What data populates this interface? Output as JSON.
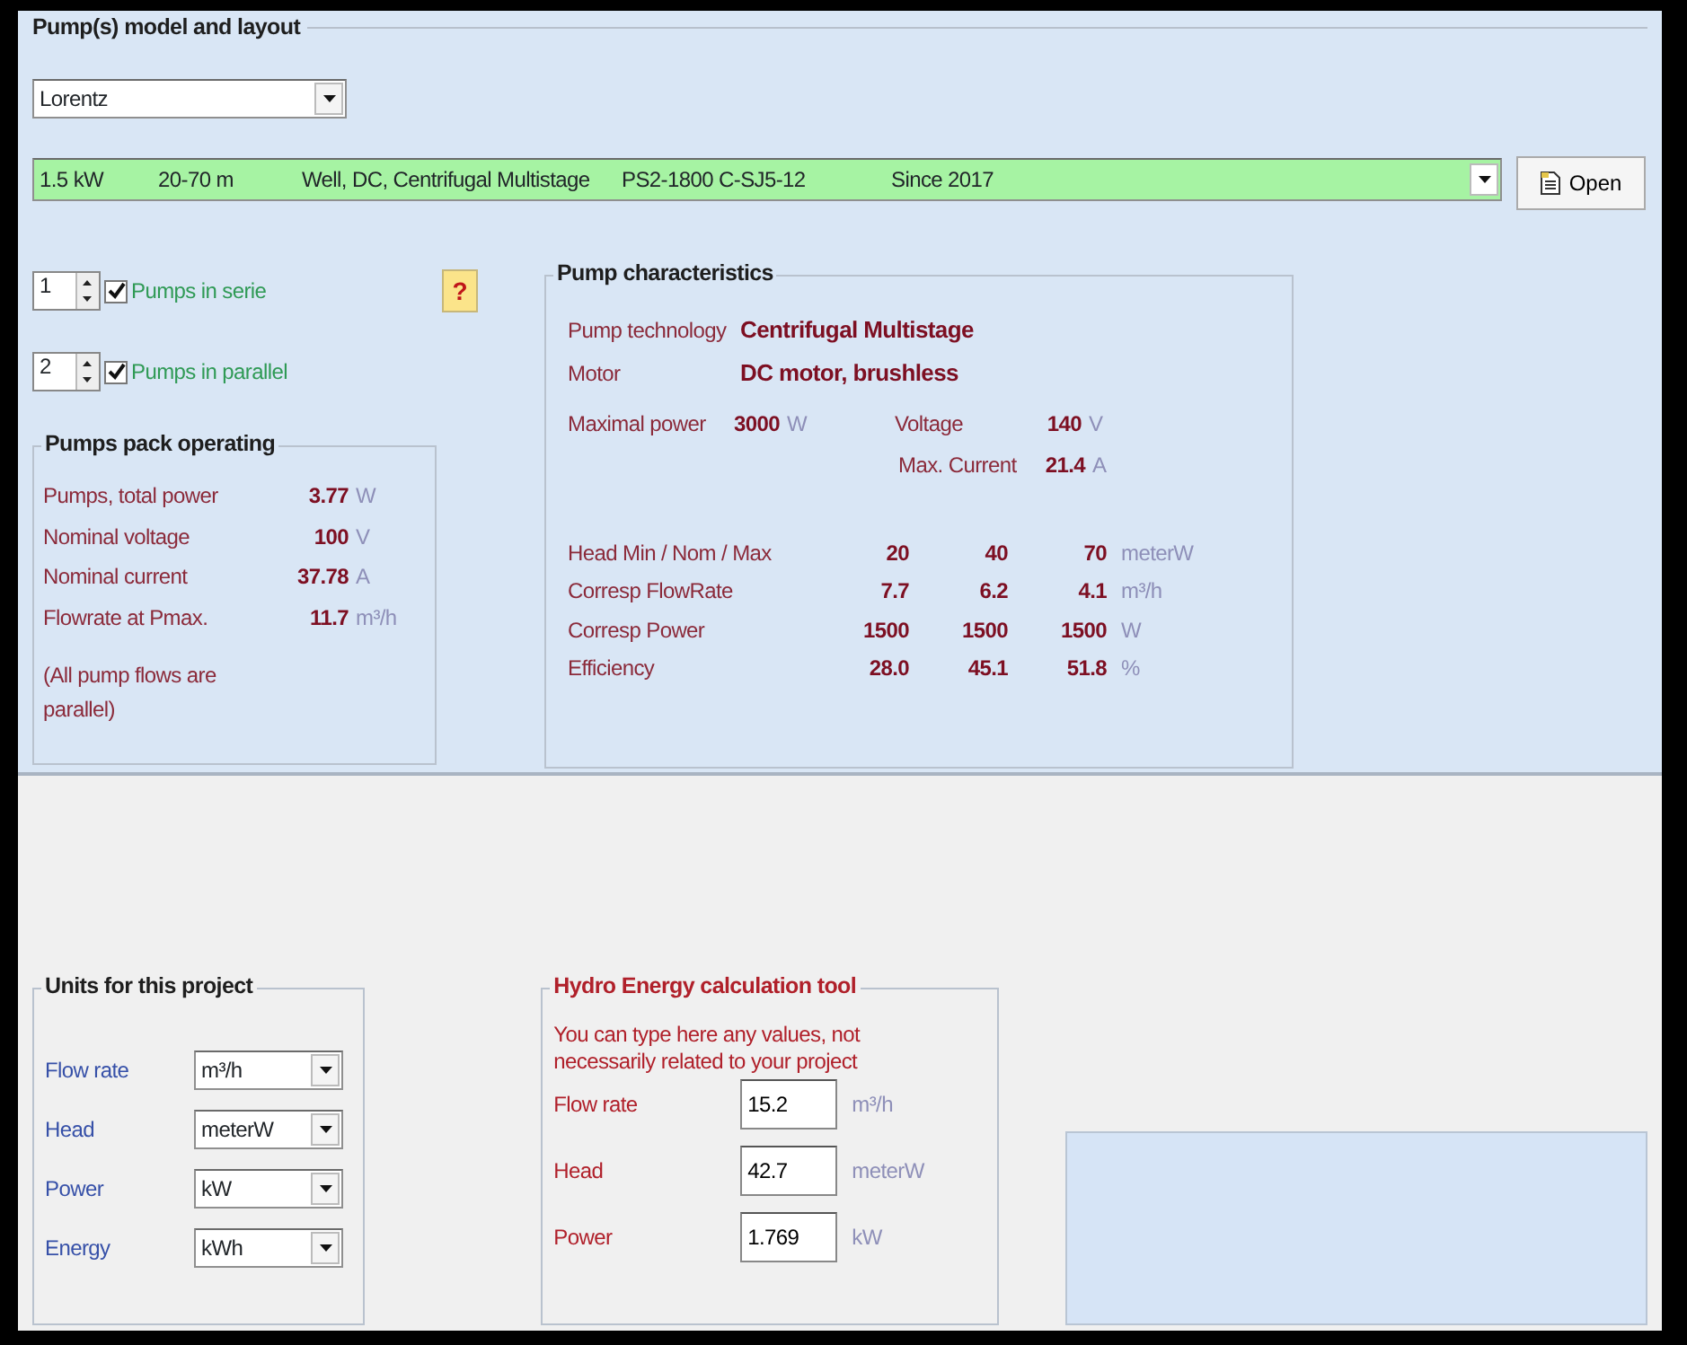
{
  "pump_panel": {
    "title": "Pump(s)  model and layout",
    "manufacturer": "Lorentz",
    "model": {
      "power": "1.5 kW",
      "head": "20-70 m",
      "type": "Well, DC, Centrifugal Multistage",
      "reference": "PS2-1800 C-SJ5-12",
      "since": "Since 2017"
    },
    "open_button": "Open",
    "help_button": "?",
    "layout": [
      {
        "count": "1",
        "label": "Pumps in serie",
        "checked": true
      },
      {
        "count": "2",
        "label": "Pumps in parallel",
        "checked": true
      }
    ]
  },
  "pack": {
    "title": "Pumps pack operating",
    "rows": [
      {
        "label": "Pumps,  total power",
        "value": "3.77",
        "unit": "W"
      },
      {
        "label": "Nominal voltage",
        "value": "100",
        "unit": "V"
      },
      {
        "label": "Nominal current",
        "value": "37.78",
        "unit": "A"
      },
      {
        "label": "Flowrate at Pmax.",
        "value": "11.7",
        "unit": "m³/h"
      }
    ],
    "note": "(All pump flows are parallel)"
  },
  "characteristics": {
    "title": "Pump characteristics",
    "technology": {
      "label": "Pump technology",
      "value": "Centrifugal Multistage"
    },
    "motor": {
      "label": "Motor",
      "value": "DC motor, brushless"
    },
    "max_power": {
      "label": "Maximal power",
      "value": "3000",
      "unit": "W"
    },
    "voltage": {
      "label": "Voltage",
      "value": "140",
      "unit": "V"
    },
    "max_current": {
      "label": "Max. Current",
      "value": "21.4",
      "unit": "A"
    },
    "table": [
      {
        "label": "Head  Min / Nom / Max",
        "values": [
          "20",
          "40",
          "70"
        ],
        "unit": "meterW"
      },
      {
        "label": "Corresp FlowRate",
        "values": [
          "7.7",
          "6.2",
          "4.1"
        ],
        "unit": "m³/h"
      },
      {
        "label": "Corresp Power",
        "values": [
          "1500",
          "1500",
          "1500"
        ],
        "unit": "W"
      },
      {
        "label": "Efficiency",
        "values": [
          "28.0",
          "45.1",
          "51.8"
        ],
        "unit": "%"
      }
    ]
  },
  "units": {
    "title": "Units for this project",
    "rows": [
      {
        "label": "Flow rate",
        "value": "m³/h"
      },
      {
        "label": "Head",
        "value": "meterW"
      },
      {
        "label": "Power",
        "value": "kW"
      },
      {
        "label": "Energy",
        "value": "kWh"
      }
    ]
  },
  "hydro": {
    "title": "Hydro Energy calculation tool",
    "note": "You can type here any values, not necessarily related to your project",
    "rows": [
      {
        "label": "Flow rate",
        "value": "15.2",
        "unit": "m³/h"
      },
      {
        "label": "Head",
        "value": "42.7",
        "unit": "meterW"
      },
      {
        "label": "Power",
        "value": "1.769",
        "unit": "kW"
      }
    ]
  }
}
